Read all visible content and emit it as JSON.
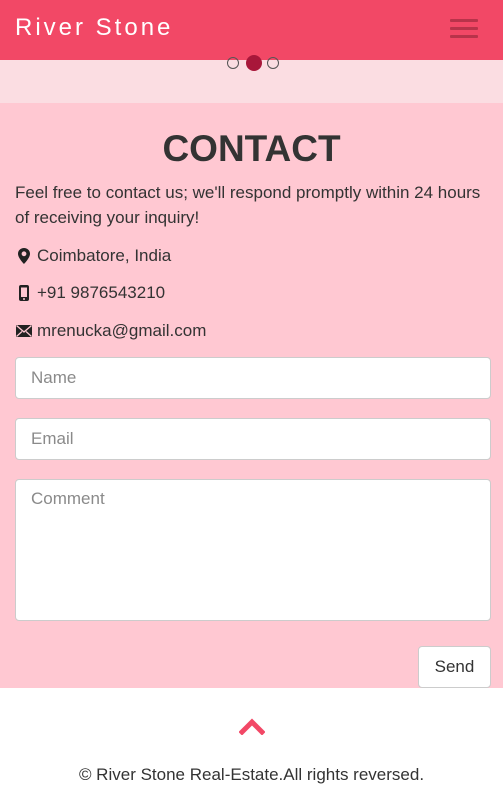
{
  "header": {
    "brand": "River Stone",
    "menu_icon": "hamburger-icon",
    "bg_color": "#f24866"
  },
  "carousel": {
    "slide_count": 3,
    "active_index": 1
  },
  "contact": {
    "title": "CONTACT",
    "intro": "Feel free to contact us; we'll respond promptly within 24 hours of receiving your inquiry!",
    "location": "Coimbatore, India",
    "phone": "+91 9876543210",
    "email": "mrenucka@gmail.com",
    "icons": [
      "map-marker-icon",
      "mobile-phone-icon",
      "envelope-icon"
    ],
    "bg_color": "#ffc8d2"
  },
  "form": {
    "name_placeholder": "Name",
    "email_placeholder": "Email",
    "comment_placeholder": "Comment",
    "send_label": "Send"
  },
  "footer": {
    "up_icon": "chevron-up-icon",
    "copyright": "© River Stone Real-Estate.All rights reversed."
  }
}
